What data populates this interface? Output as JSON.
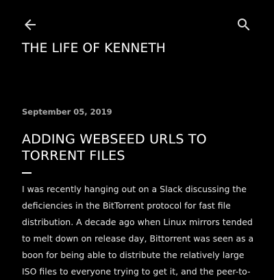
{
  "header": {
    "back_icon": "arrow-left-icon",
    "search_icon": "search-icon",
    "blog_title": "THE LIFE OF KENNETH"
  },
  "post": {
    "date": "September 05, 2019",
    "title": "ADDING WEBSEED URLS TO TORRENT FILES",
    "body": "I was recently hanging out on a Slack discussing the deficiencies in the BitTorrent protocol for fast file distribution. A decade ago when Linux mirrors tended to melt down on release day, Bittorrent was seen as a boon for being able to distribute the relatively large ISO files to everyone trying to get it, and the peer-to-"
  },
  "colors": {
    "background": "#000000",
    "text": "#ffffff",
    "date": "#a9a9a9"
  }
}
